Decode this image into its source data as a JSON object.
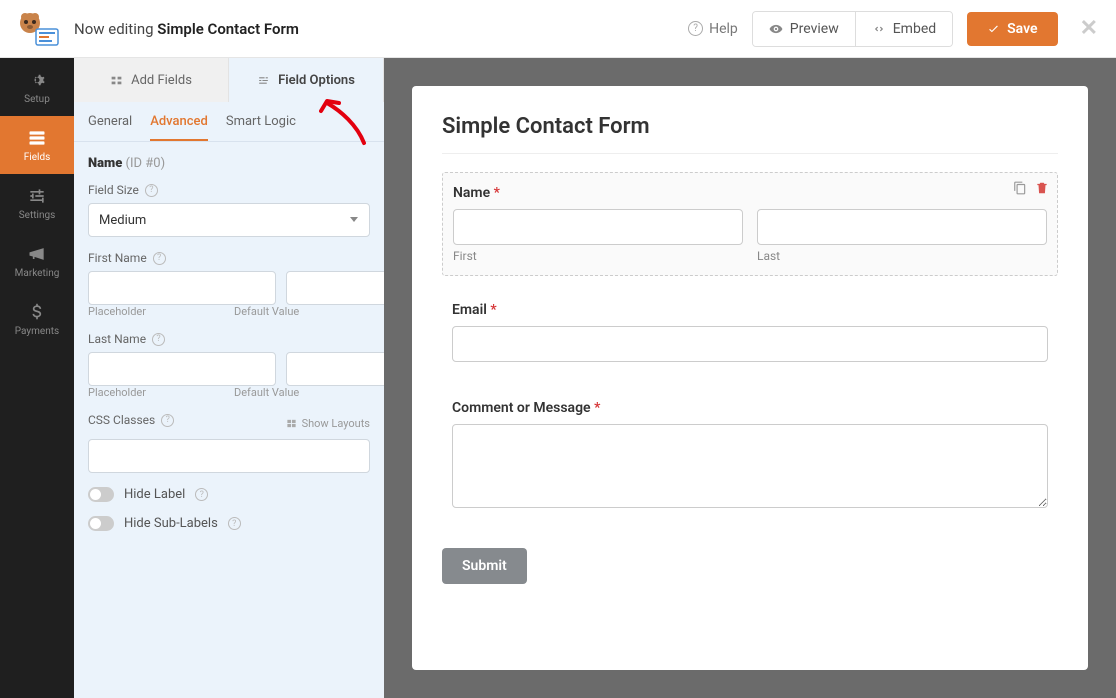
{
  "topbar": {
    "editing_prefix": "Now editing ",
    "form_name": "Simple Contact Form",
    "help": "Help",
    "preview": "Preview",
    "embed": "Embed",
    "save": "Save"
  },
  "nav": {
    "setup": "Setup",
    "fields": "Fields",
    "settings": "Settings",
    "marketing": "Marketing",
    "payments": "Payments"
  },
  "sidebar": {
    "add_fields": "Add Fields",
    "field_options": "Field Options",
    "subtabs": {
      "general": "General",
      "advanced": "Advanced",
      "smart_logic": "Smart Logic"
    },
    "field_name": "Name",
    "field_id": " (ID #0)",
    "field_size_label": "Field Size",
    "field_size_value": "Medium",
    "first_name_label": "First Name",
    "last_name_label": "Last Name",
    "placeholder_text": "Placeholder",
    "default_value_text": "Default Value",
    "css_classes_label": "CSS Classes",
    "show_layouts": "Show Layouts",
    "hide_label": "Hide Label",
    "hide_sublabels": "Hide Sub-Labels"
  },
  "preview": {
    "title": "Simple Contact Form",
    "name_label": "Name",
    "first_sub": "First",
    "last_sub": "Last",
    "email_label": "Email",
    "comment_label": "Comment or Message",
    "submit": "Submit",
    "required_marker": "*"
  }
}
